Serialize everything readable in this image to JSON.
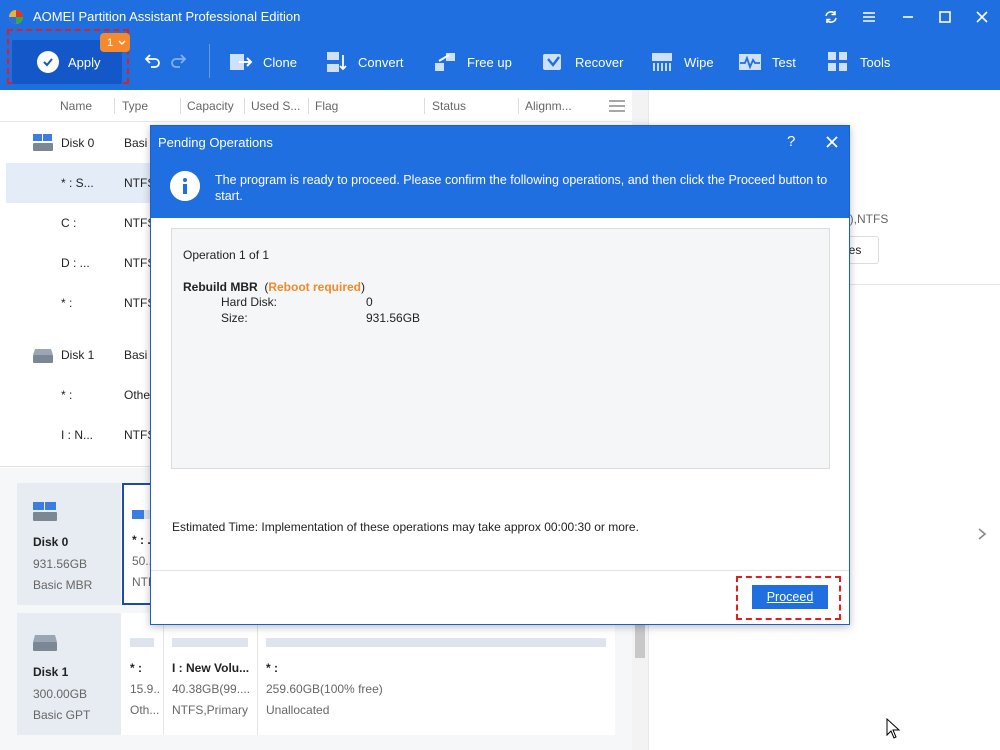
{
  "window": {
    "title": "AOMEI Partition Assistant Professional Edition"
  },
  "toolbar": {
    "apply_label": "Apply",
    "apply_badge": "1",
    "clone_label": "Clone",
    "convert_label": "Convert",
    "freeup_label": "Free up",
    "recover_label": "Recover",
    "wipe_label": "Wipe",
    "test_label": "Test",
    "tools_label": "Tools"
  },
  "columns": {
    "name": "Name",
    "type": "Type",
    "capacity": "Capacity",
    "used": "Used S...",
    "flag": "Flag",
    "status": "Status",
    "alignment": "Alignm..."
  },
  "rows": [
    {
      "name": "Disk 0",
      "type": "Basi"
    },
    {
      "name": "* : S...",
      "type": "NTFS"
    },
    {
      "name": "C :",
      "type": "NTFS"
    },
    {
      "name": "D : ...",
      "type": "NTFS"
    },
    {
      "name": "* :",
      "type": "NTFS"
    },
    {
      "name": "Disk 1",
      "type": "Basi"
    },
    {
      "name": "* :",
      "type": "Othe"
    },
    {
      "name": "I : N...",
      "type": "NTFS"
    }
  ],
  "disk_map": {
    "disk0": {
      "name": "Disk 0",
      "size": "931.56GB",
      "type": "Basic MBR",
      "partition": {
        "name": "* : ...",
        "size": "50...",
        "fs": "NTFS"
      }
    },
    "disk1": {
      "name": "Disk 1",
      "size": "300.00GB",
      "type": "Basic GPT",
      "partitions": [
        {
          "name": "* :",
          "size": "15.9...",
          "fs": "Oth..."
        },
        {
          "name": "I : New Volu...",
          "size": "40.38GB(99....",
          "fs": "NTFS,Primary"
        },
        {
          "name": "* :",
          "size": "259.60GB(100% free)",
          "fs": "Unallocated"
        }
      ]
    }
  },
  "right_panel": {
    "fs_text": "e),NTFS",
    "button_label": "ies"
  },
  "dialog": {
    "title": "Pending Operations",
    "help": "?",
    "message": "The program is ready to proceed. Please confirm the following operations, and then click the Proceed button to start.",
    "operation_count": "Operation 1 of 1",
    "operation_name": "Rebuild MBR",
    "operation_warning": "Reboot required",
    "hard_disk_label": "Hard Disk:",
    "hard_disk_value": "0",
    "size_label": "Size:",
    "size_value": "931.56GB",
    "estimated_time": "Estimated Time: Implementation of these operations may take approx 00:00:30 or more.",
    "proceed_label": "Proceed"
  },
  "colors": {
    "primary_blue": "#1f6fe0",
    "apply_blue": "#1457c8",
    "badge_orange": "#f48a2b",
    "warning_orange": "#f08a2a",
    "highlight_red": "#e02020"
  }
}
